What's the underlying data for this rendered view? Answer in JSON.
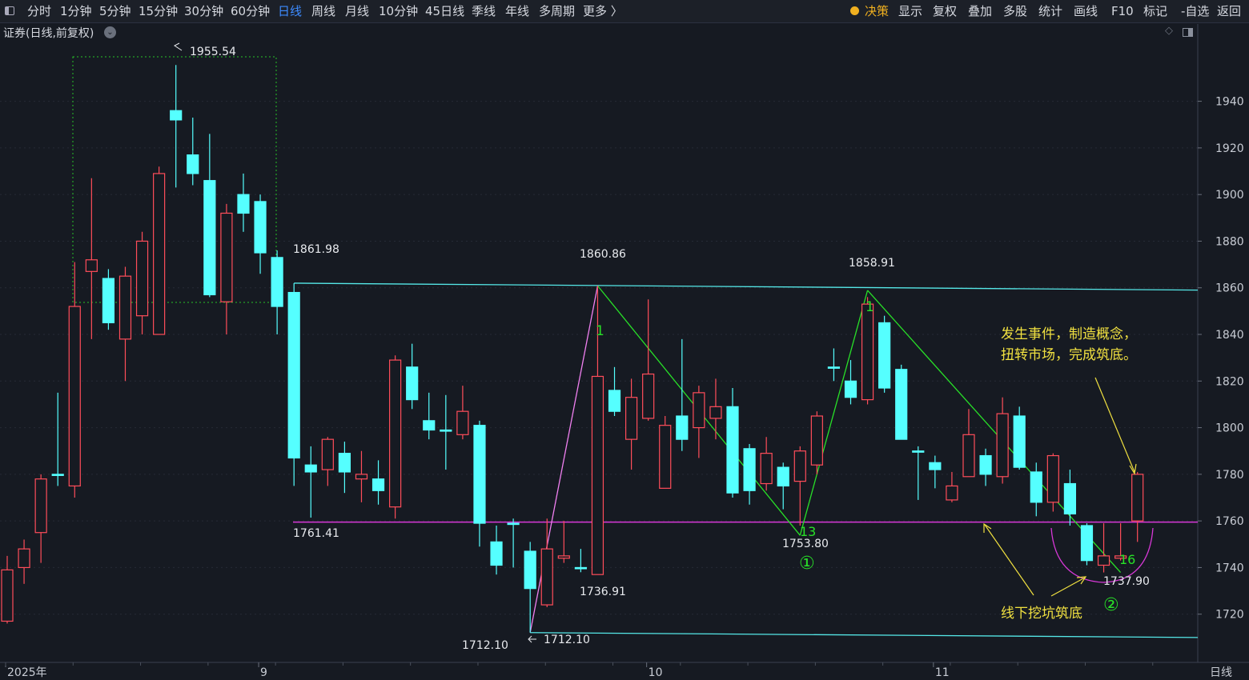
{
  "toolbar": {
    "left_tabs": [
      {
        "label": "分时"
      },
      {
        "label": "1分钟"
      },
      {
        "label": "5分钟"
      },
      {
        "label": "15分钟"
      },
      {
        "label": "30分钟"
      },
      {
        "label": "60分钟"
      },
      {
        "label": "日线",
        "active": true
      },
      {
        "label": "周线"
      },
      {
        "label": "月线"
      },
      {
        "label": "10分钟"
      },
      {
        "label": "45日线"
      },
      {
        "label": "季线"
      },
      {
        "label": "年线"
      },
      {
        "label": "多周期"
      },
      {
        "label": "更多 〉"
      }
    ],
    "right_items": [
      {
        "label": "决策",
        "icon": "bulb-icon"
      },
      {
        "label": "显示"
      },
      {
        "label": "复权"
      },
      {
        "label": "叠加"
      },
      {
        "label": "多股"
      },
      {
        "label": "统计"
      },
      {
        "label": "画线"
      },
      {
        "label": "F10"
      },
      {
        "label": "标记"
      },
      {
        "label": "-自选"
      },
      {
        "label": "返回"
      }
    ]
  },
  "chart_title": "证券(日线,前复权)",
  "colors": {
    "up": "#ff4d5a",
    "down": "#55ffff",
    "bg": "#161a22",
    "trend": "#55e8e8",
    "support": "#d838d8",
    "green": "#28e028",
    "pink": "#f080f0",
    "yellow": "#f0e040"
  },
  "price_labels": [
    "1955.54",
    "1861.98",
    "1860.86",
    "1858.91",
    "1761.41",
    "1753.80",
    "1736.91",
    "1712.10",
    "1712.10",
    "1737.90"
  ],
  "markers": [
    "1",
    "1",
    "13",
    "16",
    "①",
    "②"
  ],
  "annotations": [
    "发生事件，制造概念，",
    "扭转市场，完成筑底。",
    "线下挖坑筑底"
  ],
  "chart_data": {
    "type": "candlestick",
    "title": "证券(日线,前复权)",
    "y_ticks": [
      1720,
      1740,
      1760,
      1780,
      1800,
      1820,
      1840,
      1860,
      1880,
      1900,
      1920,
      1940
    ],
    "ylim": [
      1700,
      1968
    ],
    "x_labels": [
      {
        "label": "2025年",
        "index": 0
      },
      {
        "label": "9",
        "index": 15
      },
      {
        "label": "10",
        "index": 38
      },
      {
        "label": "11",
        "index": 55
      }
    ],
    "period_label": "日线",
    "candles": [
      {
        "o": 1717,
        "c": 1739,
        "h": 1745,
        "l": 1716
      },
      {
        "o": 1740,
        "c": 1748,
        "h": 1752,
        "l": 1733
      },
      {
        "o": 1755,
        "c": 1778,
        "h": 1780,
        "l": 1742
      },
      {
        "o": 1780,
        "c": 1780,
        "h": 1815,
        "l": 1775
      },
      {
        "o": 1775,
        "c": 1852,
        "h": 1871,
        "l": 1770
      },
      {
        "o": 1867,
        "c": 1872,
        "h": 1907,
        "l": 1838
      },
      {
        "o": 1864,
        "c": 1845,
        "h": 1868,
        "l": 1842
      },
      {
        "o": 1838,
        "c": 1865,
        "h": 1869,
        "l": 1820
      },
      {
        "o": 1848,
        "c": 1880,
        "h": 1884,
        "l": 1840
      },
      {
        "o": 1840,
        "c": 1909,
        "h": 1912,
        "l": 1840
      },
      {
        "o": 1936,
        "c": 1932,
        "h": 1955.54,
        "l": 1903
      },
      {
        "o": 1917,
        "c": 1909,
        "h": 1933,
        "l": 1904
      },
      {
        "o": 1906,
        "c": 1857,
        "h": 1926,
        "l": 1856
      },
      {
        "o": 1854,
        "c": 1892,
        "h": 1896,
        "l": 1840
      },
      {
        "o": 1900,
        "c": 1892,
        "h": 1909,
        "l": 1884
      },
      {
        "o": 1897,
        "c": 1875,
        "h": 1900,
        "l": 1866
      },
      {
        "o": 1873,
        "c": 1852,
        "h": 1876,
        "l": 1840
      },
      {
        "o": 1858,
        "c": 1787,
        "h": 1861.98,
        "l": 1775
      },
      {
        "o": 1784,
        "c": 1781,
        "h": 1792,
        "l": 1761.41
      },
      {
        "o": 1782,
        "c": 1795,
        "h": 1796,
        "l": 1775
      },
      {
        "o": 1789,
        "c": 1781,
        "h": 1794,
        "l": 1772
      },
      {
        "o": 1778,
        "c": 1780,
        "h": 1790,
        "l": 1768
      },
      {
        "o": 1778,
        "c": 1773,
        "h": 1786,
        "l": 1767
      },
      {
        "o": 1766,
        "c": 1829,
        "h": 1831,
        "l": 1761
      },
      {
        "o": 1826,
        "c": 1812,
        "h": 1836,
        "l": 1808
      },
      {
        "o": 1803,
        "c": 1799,
        "h": 1815,
        "l": 1795
      },
      {
        "o": 1799,
        "c": 1799,
        "h": 1814,
        "l": 1782
      },
      {
        "o": 1797,
        "c": 1807,
        "h": 1818,
        "l": 1795
      },
      {
        "o": 1801,
        "c": 1759,
        "h": 1803,
        "l": 1749
      },
      {
        "o": 1751,
        "c": 1741,
        "h": 1758,
        "l": 1737
      },
      {
        "o": 1759,
        "c": 1759,
        "h": 1761,
        "l": 1740
      },
      {
        "o": 1747,
        "c": 1731,
        "h": 1751,
        "l": 1712.1
      },
      {
        "o": 1724,
        "c": 1748,
        "h": 1761,
        "l": 1723
      },
      {
        "o": 1744,
        "c": 1745,
        "h": 1760,
        "l": 1742
      },
      {
        "o": 1740,
        "c": 1740,
        "h": 1748,
        "l": 1738
      },
      {
        "o": 1737,
        "c": 1822,
        "h": 1860.86,
        "l": 1736.91
      },
      {
        "o": 1816,
        "c": 1807,
        "h": 1826,
        "l": 1805
      },
      {
        "o": 1795,
        "c": 1813,
        "h": 1821,
        "l": 1782
      },
      {
        "o": 1804,
        "c": 1823,
        "h": 1855,
        "l": 1803
      },
      {
        "o": 1774,
        "c": 1801,
        "h": 1805,
        "l": 1774
      },
      {
        "o": 1805,
        "c": 1795,
        "h": 1838,
        "l": 1790
      },
      {
        "o": 1800,
        "c": 1815,
        "h": 1818,
        "l": 1787
      },
      {
        "o": 1804,
        "c": 1809,
        "h": 1821,
        "l": 1795
      },
      {
        "o": 1809,
        "c": 1772,
        "h": 1817,
        "l": 1770
      },
      {
        "o": 1791,
        "c": 1773,
        "h": 1793,
        "l": 1767
      },
      {
        "o": 1776,
        "c": 1789,
        "h": 1796,
        "l": 1773
      },
      {
        "o": 1783,
        "c": 1775,
        "h": 1785,
        "l": 1765
      },
      {
        "o": 1777,
        "c": 1790,
        "h": 1792,
        "l": 1758
      },
      {
        "o": 1784,
        "c": 1805,
        "h": 1807,
        "l": 1780
      },
      {
        "o": 1826,
        "c": 1826,
        "h": 1834,
        "l": 1820
      },
      {
        "o": 1820,
        "c": 1813,
        "h": 1829,
        "l": 1810
      },
      {
        "o": 1812,
        "c": 1853,
        "h": 1856,
        "l": 1810
      },
      {
        "o": 1845,
        "c": 1817,
        "h": 1848,
        "l": 1815
      },
      {
        "o": 1825,
        "c": 1795,
        "h": 1827,
        "l": 1795
      },
      {
        "o": 1790,
        "c": 1790,
        "h": 1792,
        "l": 1769
      },
      {
        "o": 1785,
        "c": 1782,
        "h": 1788,
        "l": 1774
      },
      {
        "o": 1769,
        "c": 1775,
        "h": 1781,
        "l": 1768
      },
      {
        "o": 1779,
        "c": 1797,
        "h": 1808,
        "l": 1779
      },
      {
        "o": 1788,
        "c": 1780,
        "h": 1791,
        "l": 1775
      },
      {
        "o": 1779,
        "c": 1806,
        "h": 1813,
        "l": 1776
      },
      {
        "o": 1805,
        "c": 1783,
        "h": 1809,
        "l": 1782
      },
      {
        "o": 1781,
        "c": 1768,
        "h": 1785,
        "l": 1762
      },
      {
        "o": 1768,
        "c": 1788,
        "h": 1789,
        "l": 1764
      },
      {
        "o": 1776,
        "c": 1763,
        "h": 1782,
        "l": 1758
      },
      {
        "o": 1758,
        "c": 1743,
        "h": 1759,
        "l": 1741
      },
      {
        "o": 1741,
        "c": 1745,
        "h": 1759,
        "l": 1737.9
      },
      {
        "o": 1744,
        "c": 1745,
        "h": 1759,
        "l": 1743
      },
      {
        "o": 1760,
        "c": 1780,
        "h": 1781,
        "l": 1751
      }
    ],
    "lines": {
      "resistance": {
        "from": {
          "index": 17,
          "price": 1861.98
        },
        "to": {
          "index": 72,
          "price": 1859
        }
      },
      "support": {
        "price": 1759.5
      },
      "lower": {
        "from": {
          "index": 31,
          "price": 1712.1
        },
        "to": {
          "index": 72,
          "price": 1710
        }
      },
      "legs": [
        {
          "from": {
            "index": 31,
            "price": 1712.1
          },
          "to": {
            "index": 35,
            "price": 1860.86
          }
        },
        {
          "from": {
            "index": 35,
            "price": 1860.86
          },
          "to": {
            "index": 47,
            "price": 1753.8
          }
        },
        {
          "from": {
            "index": 47,
            "price": 1753.8
          },
          "to": {
            "index": 51,
            "price": 1858.91
          }
        },
        {
          "from": {
            "index": 51,
            "price": 1858.91
          },
          "to": {
            "index": 66,
            "price": 1737.9
          }
        }
      ]
    }
  }
}
